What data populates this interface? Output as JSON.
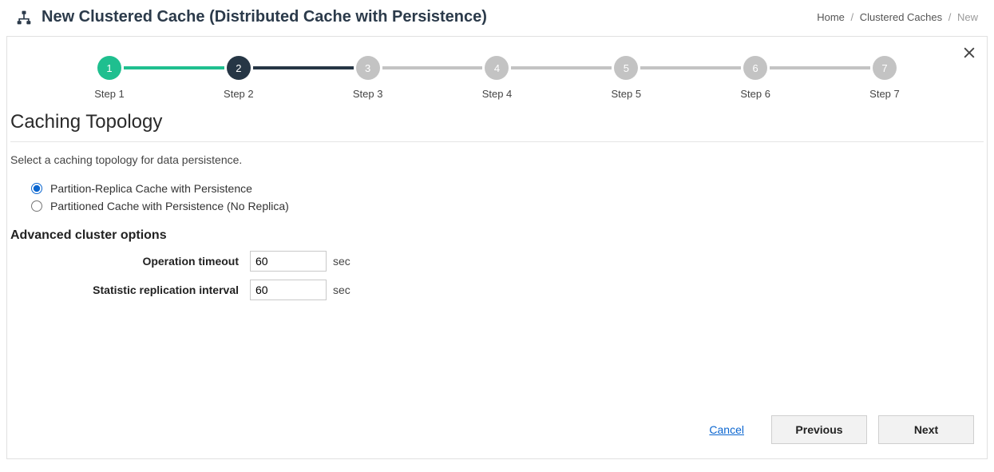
{
  "header": {
    "title": "New Clustered Cache (Distributed Cache with Persistence)"
  },
  "breadcrumb": {
    "home": "Home",
    "section": "Clustered Caches",
    "current": "New"
  },
  "stepper": {
    "steps": [
      {
        "num": "1",
        "label": "Step 1",
        "state": "done"
      },
      {
        "num": "2",
        "label": "Step 2",
        "state": "active"
      },
      {
        "num": "3",
        "label": "Step 3",
        "state": "pending"
      },
      {
        "num": "4",
        "label": "Step 4",
        "state": "pending"
      },
      {
        "num": "5",
        "label": "Step 5",
        "state": "pending"
      },
      {
        "num": "6",
        "label": "Step 6",
        "state": "pending"
      },
      {
        "num": "7",
        "label": "Step 7",
        "state": "pending"
      }
    ]
  },
  "page": {
    "section_title": "Caching Topology",
    "description": "Select a caching topology for data persistence.",
    "radios": {
      "opt1": "Partition-Replica Cache with Persistence",
      "opt2": "Partitioned Cache with Persistence (No Replica)"
    },
    "advanced_title": "Advanced cluster options",
    "fields": {
      "operation_timeout_label": "Operation timeout",
      "operation_timeout_value": "60",
      "operation_timeout_unit": "sec",
      "stat_replication_label": "Statistic replication interval",
      "stat_replication_value": "60",
      "stat_replication_unit": "sec"
    }
  },
  "footer": {
    "cancel": "Cancel",
    "previous": "Previous",
    "next": "Next"
  }
}
